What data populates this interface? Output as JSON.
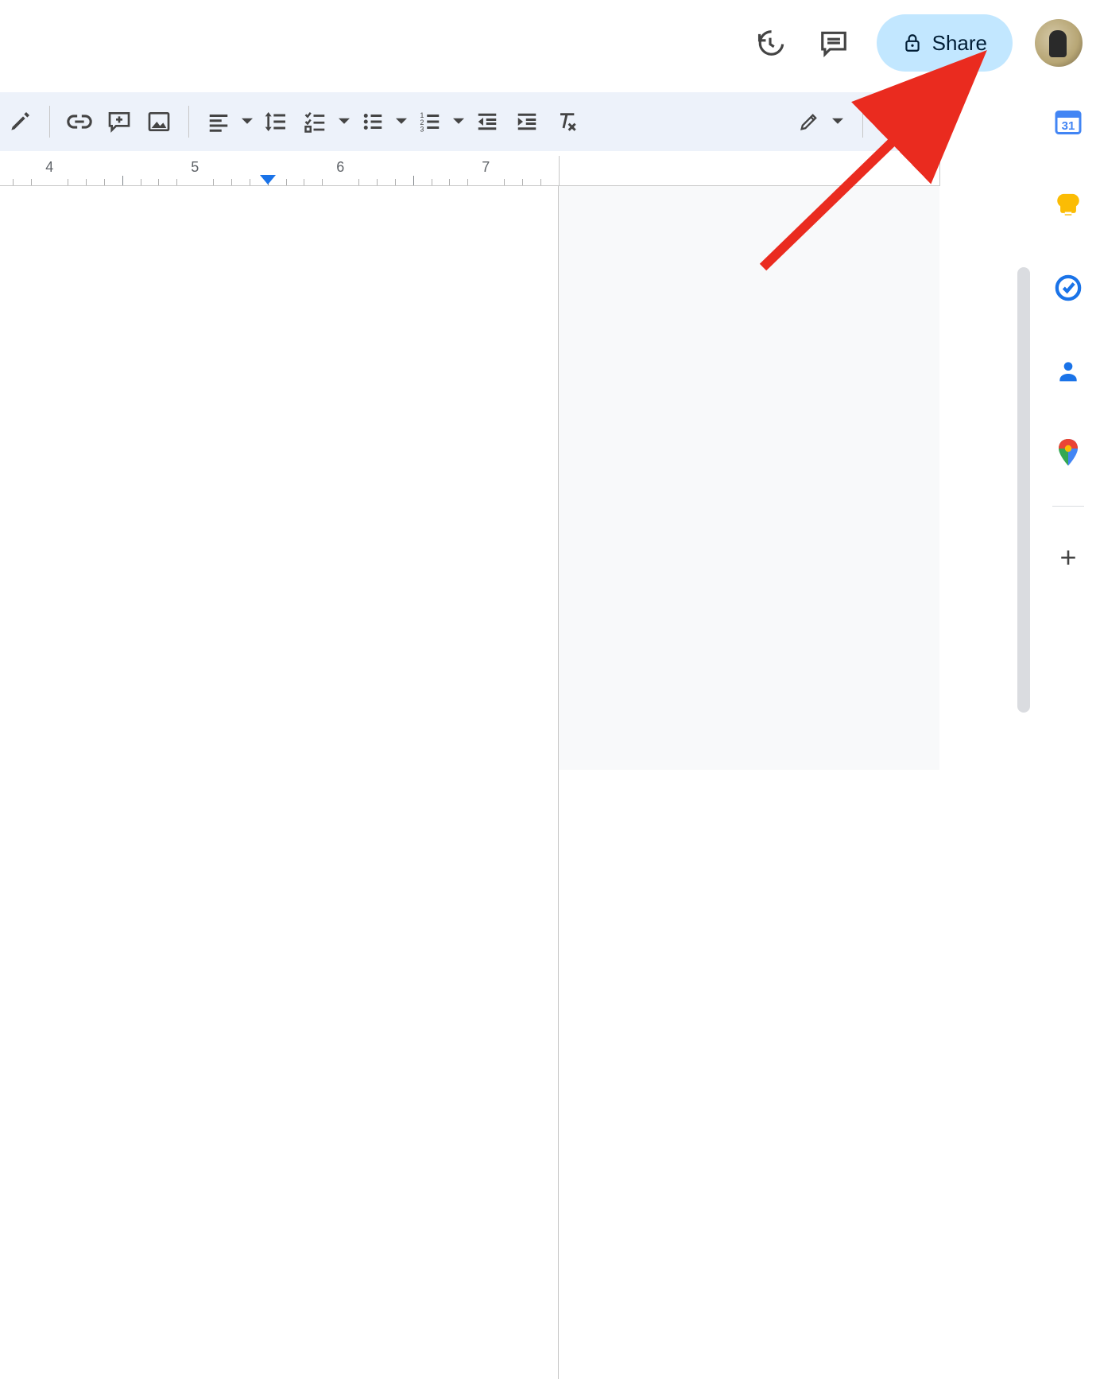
{
  "header": {
    "share_label": "Share",
    "icons": {
      "history": "version-history-icon",
      "comments": "comments-icon",
      "lock": "lock-icon",
      "avatar": "account-avatar"
    }
  },
  "toolbar": {
    "items": [
      {
        "name": "highlight-color",
        "icon": "highlighter-icon"
      },
      {
        "name": "insert-link",
        "icon": "link-icon"
      },
      {
        "name": "add-comment",
        "icon": "add-comment-icon"
      },
      {
        "name": "insert-image",
        "icon": "image-icon"
      },
      {
        "name": "align",
        "icon": "align-left-icon",
        "dropdown": true
      },
      {
        "name": "line-spacing",
        "icon": "line-spacing-icon"
      },
      {
        "name": "checklist",
        "icon": "checklist-icon",
        "dropdown": true
      },
      {
        "name": "bulleted-list",
        "icon": "bulleted-list-icon",
        "dropdown": true
      },
      {
        "name": "numbered-list",
        "icon": "numbered-list-icon",
        "dropdown": true
      },
      {
        "name": "decrease-indent",
        "icon": "decrease-indent-icon"
      },
      {
        "name": "increase-indent",
        "icon": "increase-indent-icon"
      },
      {
        "name": "clear-formatting",
        "icon": "clear-formatting-icon"
      }
    ],
    "mode": {
      "name": "editing-mode",
      "icon": "pencil-icon",
      "dropdown": true
    },
    "collapse": {
      "name": "hide-menus",
      "icon": "chevron-up-icon"
    }
  },
  "ruler": {
    "major_ticks": [
      4,
      5,
      6,
      7
    ],
    "margin_marker_at": 5.5,
    "page_right_edge_at": 7.5
  },
  "side_panel": {
    "apps": [
      {
        "name": "calendar",
        "label": "Calendar"
      },
      {
        "name": "keep",
        "label": "Keep"
      },
      {
        "name": "tasks",
        "label": "Tasks"
      },
      {
        "name": "contacts",
        "label": "Contacts"
      },
      {
        "name": "maps",
        "label": "Maps"
      }
    ],
    "add": "+"
  },
  "annotation": {
    "type": "arrow",
    "color": "#ff0000",
    "points_to": "account-avatar"
  }
}
